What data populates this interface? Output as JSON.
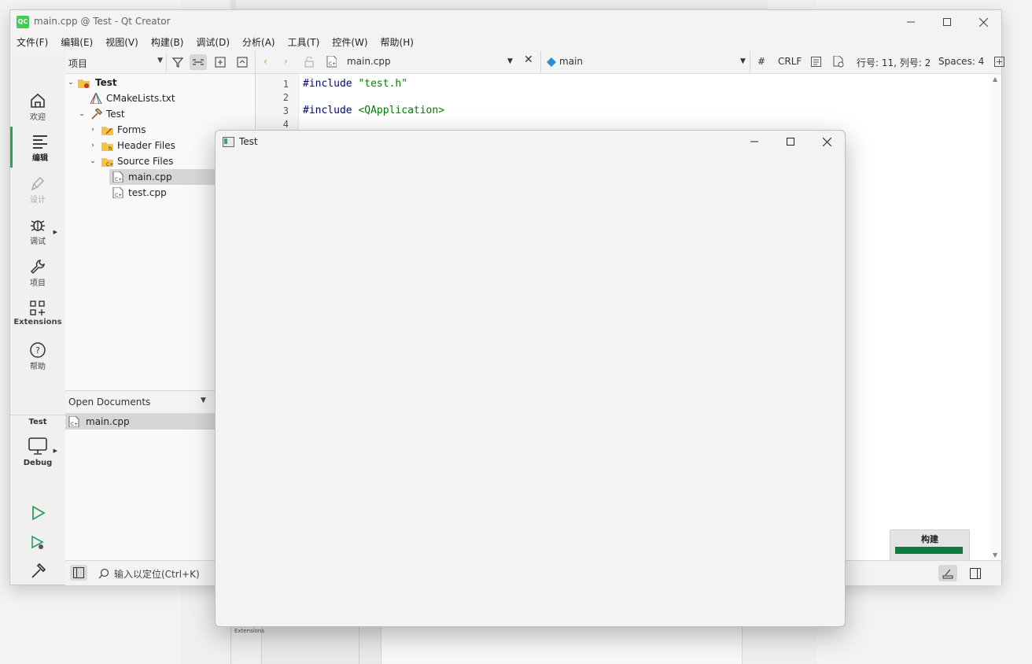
{
  "window": {
    "title": "main.cpp @ Test - Qt Creator",
    "logo": "QC",
    "controls": [
      "minimize-icon",
      "maximize-icon",
      "close-icon"
    ]
  },
  "menubar": [
    "文件(F)",
    "编辑(E)",
    "视图(V)",
    "构建(B)",
    "调试(D)",
    "分析(A)",
    "工具(T)",
    "控件(W)",
    "帮助(H)"
  ],
  "modes": [
    {
      "label": "欢迎",
      "icon": "home-icon"
    },
    {
      "label": "编辑",
      "icon": "edit-lines-icon"
    },
    {
      "label": "设计",
      "icon": "pen-icon"
    },
    {
      "label": "调试",
      "icon": "bug-icon"
    },
    {
      "label": "项目",
      "icon": "wrench-icon"
    },
    {
      "label": "Extensions",
      "icon": "extensions-icon"
    },
    {
      "label": "帮助",
      "icon": "help-icon"
    }
  ],
  "kit": {
    "project": "Test",
    "build_config": "Debug"
  },
  "project_panel": {
    "selector_label": "项目",
    "tree": [
      {
        "label": "Test",
        "bold": true
      },
      {
        "label": "CMakeLists.txt"
      },
      {
        "label": "Test"
      },
      {
        "label": "Forms"
      },
      {
        "label": "Header Files"
      },
      {
        "label": "Source Files"
      },
      {
        "label": "main.cpp",
        "selected": true
      },
      {
        "label": "test.cpp"
      }
    ],
    "open_documents_label": "Open Documents",
    "open_documents": [
      "main.cpp"
    ]
  },
  "locator": {
    "placeholder": "输入以定位(Ctrl+K)"
  },
  "editor_toolbar": {
    "file": "main.cpp",
    "symbol": "main",
    "hash": "#",
    "line_ending": "CRLF",
    "position": "行号: 11, 列号: 2",
    "spaces": "Spaces: 4"
  },
  "code": {
    "line_numbers": [
      "1",
      "2",
      "3",
      "4"
    ],
    "lines": [
      {
        "kw": "#include",
        "str": " \"test.h\""
      },
      {
        "kw": "",
        "str": ""
      },
      {
        "kw": "#include",
        "str": " <QApplication>"
      }
    ]
  },
  "build_progress": {
    "label": "构建",
    "progress": 1.0,
    "color": "#0f7b3f"
  },
  "test_window": {
    "title": "Test"
  }
}
